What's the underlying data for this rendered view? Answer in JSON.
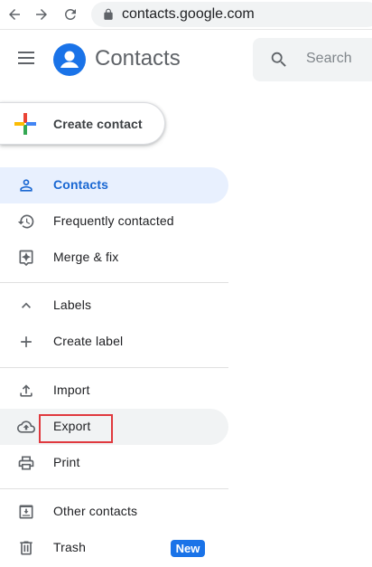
{
  "browser": {
    "url": "contacts.google.com",
    "icons": {
      "back": "arrow-back-icon",
      "forward": "arrow-forward-icon",
      "reload": "reload-icon",
      "lock": "lock-icon"
    }
  },
  "header": {
    "title": "Contacts",
    "search_placeholder": "Search"
  },
  "create_button": {
    "label": "Create contact",
    "icon": "multicolor-plus-icon"
  },
  "sidebar": {
    "items": [
      {
        "id": "contacts",
        "label": "Contacts",
        "icon": "person-icon",
        "state": "active"
      },
      {
        "id": "frequently-contacted",
        "label": "Frequently contacted",
        "icon": "history-icon"
      },
      {
        "id": "merge-fix",
        "label": "Merge & fix",
        "icon": "merge-sparkle-icon"
      },
      {
        "id": "labels",
        "label": "Labels",
        "icon": "chevron-up-icon"
      },
      {
        "id": "create-label",
        "label": "Create label",
        "icon": "plus-icon"
      },
      {
        "id": "import",
        "label": "Import",
        "icon": "upload-icon"
      },
      {
        "id": "export",
        "label": "Export",
        "icon": "cloud-upload-icon",
        "state": "hover",
        "highlighted": true
      },
      {
        "id": "print",
        "label": "Print",
        "icon": "printer-icon"
      },
      {
        "id": "other-contacts",
        "label": "Other contacts",
        "icon": "archive-download-icon"
      },
      {
        "id": "trash",
        "label": "Trash",
        "icon": "trash-icon",
        "badge": "New"
      }
    ]
  },
  "colors": {
    "accent": "#1a73e8",
    "active_bg": "#e8f0fe",
    "active_text": "#1967d2",
    "hover_bg": "#f1f3f4",
    "highlight_border": "#e0393e",
    "icon": "#5f6368"
  }
}
